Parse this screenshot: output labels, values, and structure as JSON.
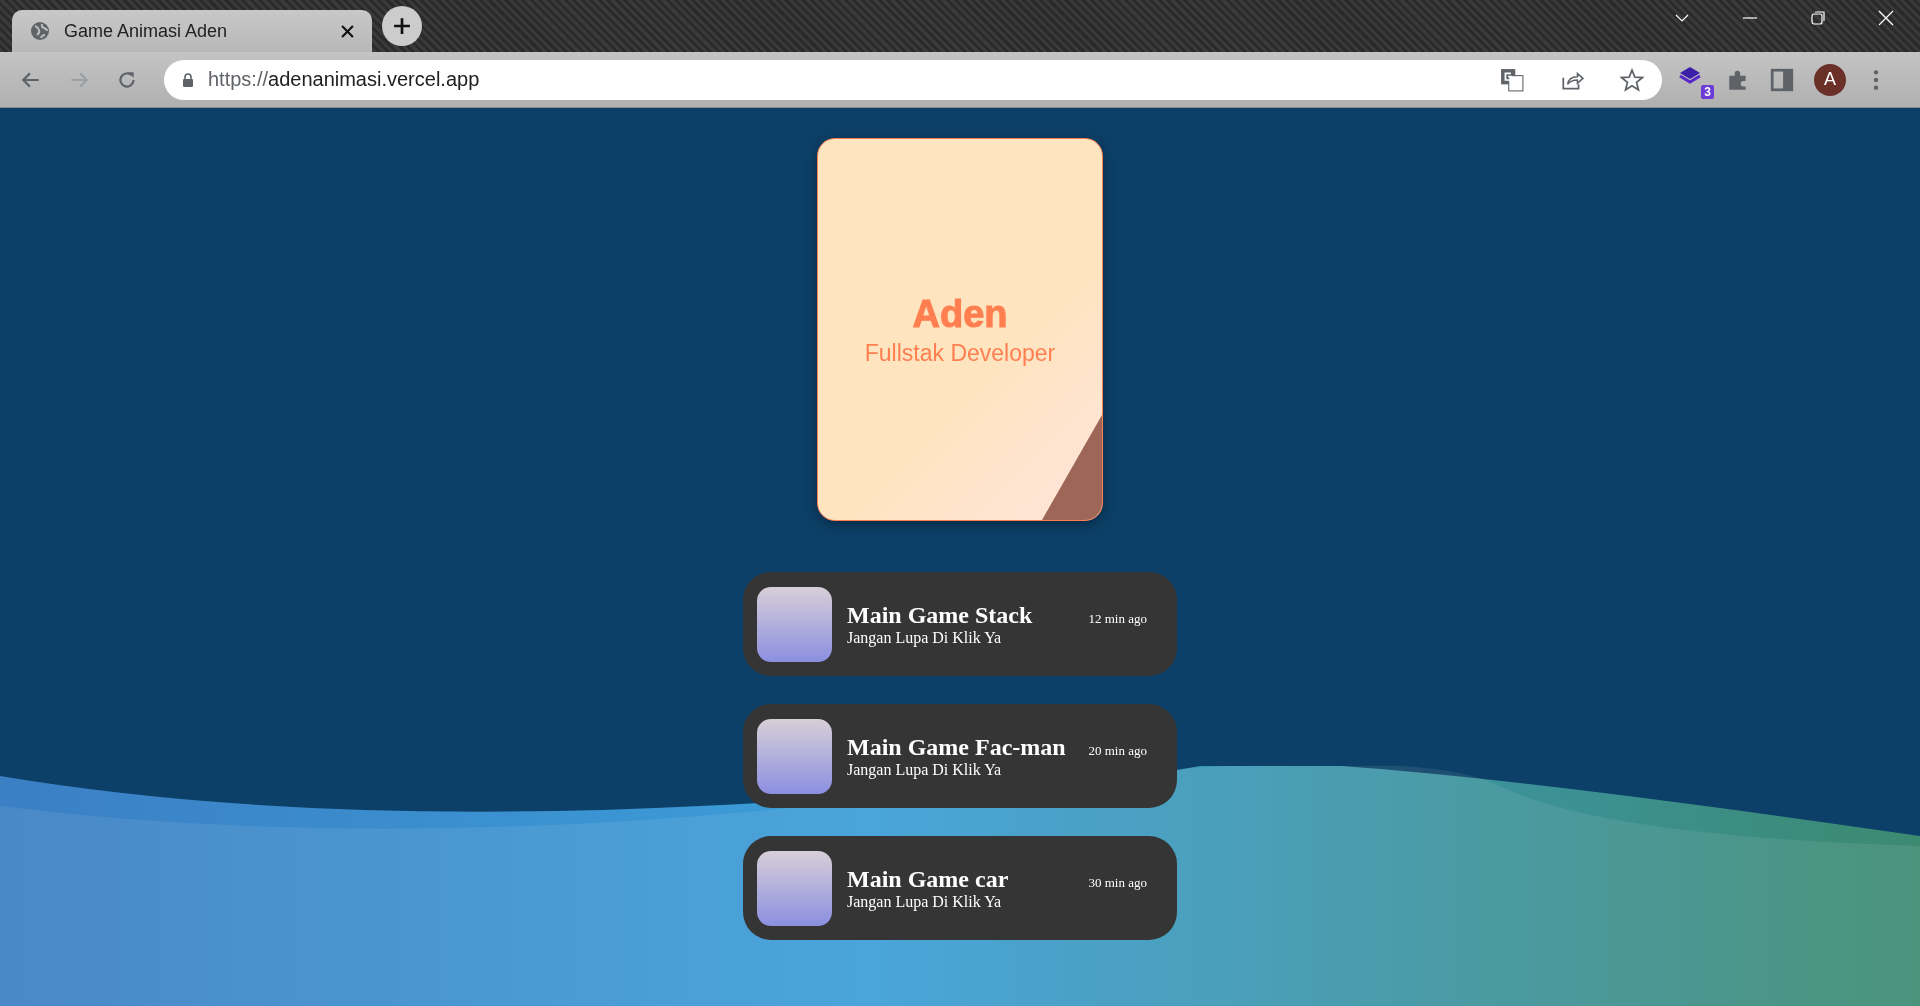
{
  "browser": {
    "tab_title": "Game Animasi Aden",
    "url_scheme": "https://",
    "url_host": "adenanimasi.vercel.app",
    "extension_badge": "3",
    "avatar_letter": "A"
  },
  "profile_card": {
    "name": "Aden",
    "role": "Fullstak Developer"
  },
  "games": [
    {
      "title": "Main Game Stack",
      "subtitle": "Jangan Lupa Di Klik Ya",
      "time": "12 min ago"
    },
    {
      "title": "Main Game Fac-man",
      "subtitle": "Jangan Lupa Di Klik Ya",
      "time": "20 min ago"
    },
    {
      "title": "Main Game car",
      "subtitle": "Jangan Lupa Di Klik Ya",
      "time": "30 min ago"
    }
  ]
}
